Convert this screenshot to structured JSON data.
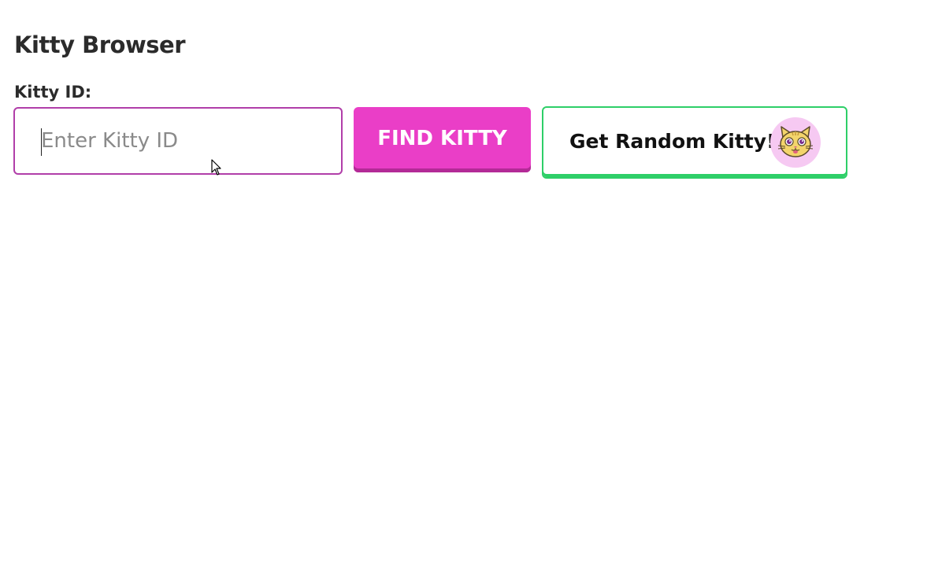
{
  "page": {
    "title": "Kitty Browser"
  },
  "form": {
    "label": "Kitty ID:",
    "input_value": "",
    "input_placeholder": "Enter Kitty ID",
    "find_button_label": "FIND KITTY",
    "random_button_label": "Get Random Kitty!"
  },
  "icons": {
    "kitty_avatar": "cat-face-icon",
    "mouse_cursor": "arrow-cursor-icon"
  },
  "colors": {
    "input_border": "#b13ea9",
    "find_button": "#ea3ec7",
    "random_button_border": "#2ecf68",
    "avatar_background": "#f6c9f2",
    "kitty_fur": "#f3d46b"
  }
}
